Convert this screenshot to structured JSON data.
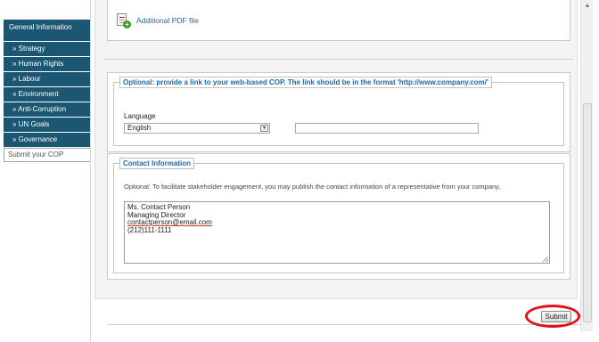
{
  "sidebar": {
    "title": "General Information",
    "items": [
      {
        "label": "» Strategy"
      },
      {
        "label": "» Human Rights"
      },
      {
        "label": "» Labour"
      },
      {
        "label": "» Environment"
      },
      {
        "label": "» Anti-Corruption"
      },
      {
        "label": "» UN Goals"
      },
      {
        "label": "» Governance"
      }
    ],
    "active_item": "Submit your COP"
  },
  "attachments": {
    "pdf_link_label": "Additional PDF file",
    "pdf_icon": "pdf-add-icon"
  },
  "web_cop": {
    "legend": "Optional: provide a link to your web-based COP. The link should be in the format 'http://www.company.com/'",
    "language_label": "Language",
    "language_value": "English",
    "url_value": ""
  },
  "contact": {
    "legend": "Contact Information",
    "description": "Optional: To facilitate stakeholder engagement, you may publish the contact information of a representative from your company.",
    "lines": [
      "Ms. Contact Person",
      "Managing Director",
      "contactperson@email.com",
      "(212)111-1111"
    ]
  },
  "submit_label": "Submit",
  "colors": {
    "sidebar_bg": "#1b5772",
    "legend_text": "#2466a1",
    "highlight_ring": "#e0101a"
  }
}
